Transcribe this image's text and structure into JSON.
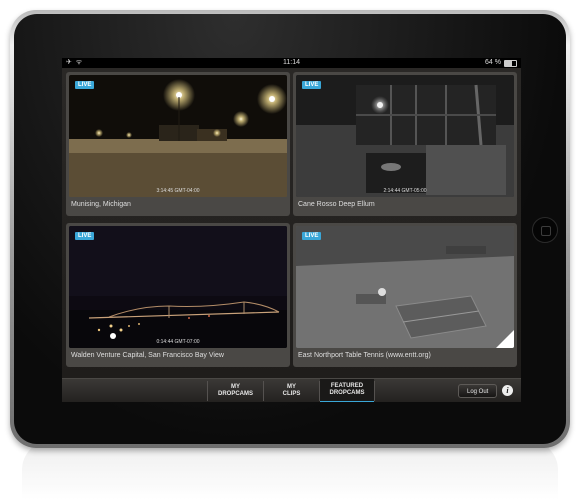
{
  "status_bar": {
    "left_icons": "✈ ᯤ",
    "time": "11:14",
    "battery_text": "64 %",
    "battery_level": 0.64
  },
  "cameras": [
    {
      "live": "LIVE",
      "name": "Munising, Michigan",
      "timestamp": "3:14:45 GMT-04:00"
    },
    {
      "live": "LIVE",
      "name": "Cane Rosso Deep Ellum",
      "timestamp": "2:14:44 GMT-05:00"
    },
    {
      "live": "LIVE",
      "name": "Walden Venture Capital, San Francisco Bay View",
      "timestamp": "0:14:44 GMT-07:00"
    },
    {
      "live": "LIVE",
      "name": "East Northport Table Tennis (www.entt.org)",
      "timestamp": ""
    }
  ],
  "pager": {
    "count": 8,
    "active_index": 0
  },
  "tabs": [
    {
      "line1": "MY",
      "line2": "DROPCAMS"
    },
    {
      "line1": "MY",
      "line2": "CLIPS"
    },
    {
      "line1": "FEATURED",
      "line2": "DROPCAMS",
      "active": true
    }
  ],
  "actions": {
    "logout_label": "Log Out",
    "info_label": "i"
  },
  "colors": {
    "accent": "#3aa7d8",
    "live_badge": "#3aa7d8"
  }
}
